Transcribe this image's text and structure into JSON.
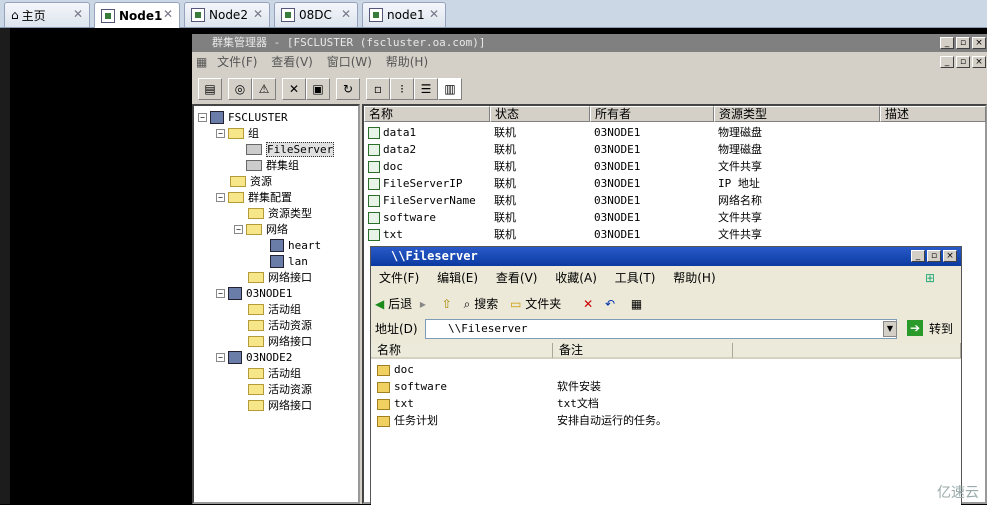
{
  "tabs": [
    {
      "label": "主页"
    },
    {
      "label": "Node1"
    },
    {
      "label": "Node2"
    },
    {
      "label": "08DC"
    },
    {
      "label": "node1"
    }
  ],
  "cluster_admin": {
    "title": "群集管理器 - [FSCLUSTER (fscluster.oa.com)]",
    "menu": [
      "文件(F)",
      "查看(V)",
      "窗口(W)",
      "帮助(H)"
    ],
    "tree": [
      {
        "label": "FSCLUSTER",
        "toggle": "-"
      },
      {
        "label": "组",
        "toggle": "-"
      },
      {
        "label": "FileServer"
      },
      {
        "label": "群集组"
      },
      {
        "label": "资源"
      },
      {
        "label": "群集配置",
        "toggle": "-"
      },
      {
        "label": "资源类型"
      },
      {
        "label": "网络",
        "toggle": "-"
      },
      {
        "label": "heart"
      },
      {
        "label": "lan"
      },
      {
        "label": "网络接口"
      },
      {
        "label": "03NODE1",
        "toggle": "-"
      },
      {
        "label": "活动组"
      },
      {
        "label": "活动资源"
      },
      {
        "label": "网络接口"
      },
      {
        "label": "03NODE2",
        "toggle": "-"
      },
      {
        "label": "活动组"
      },
      {
        "label": "活动资源"
      },
      {
        "label": "网络接口"
      }
    ],
    "columns": [
      "名称",
      "状态",
      "所有者",
      "资源类型",
      "描述"
    ],
    "rows": [
      [
        "data1",
        "联机",
        "03NODE1",
        "物理磁盘"
      ],
      [
        "data2",
        "联机",
        "03NODE1",
        "物理磁盘"
      ],
      [
        "doc",
        "联机",
        "03NODE1",
        "文件共享"
      ],
      [
        "FileServerIP",
        "联机",
        "03NODE1",
        "IP 地址"
      ],
      [
        "FileServerName",
        "联机",
        "03NODE1",
        "网络名称"
      ],
      [
        "software",
        "联机",
        "03NODE1",
        "文件共享"
      ],
      [
        "txt",
        "联机",
        "03NODE1",
        "文件共享"
      ]
    ]
  },
  "explorer": {
    "title": "\\\\Fileserver",
    "menu": [
      "文件(F)",
      "编辑(E)",
      "查看(V)",
      "收藏(A)",
      "工具(T)",
      "帮助(H)"
    ],
    "back": "后退",
    "search": "搜索",
    "folders": "文件夹",
    "address_label": "地址(D)",
    "address": "\\\\Fileserver",
    "go": "转到",
    "columns": [
      "名称",
      "备注"
    ],
    "rows": [
      [
        "doc",
        ""
      ],
      [
        "software",
        "软件安装"
      ],
      [
        "txt",
        "txt文档"
      ],
      [
        "任务计划",
        "安排自动运行的任务。"
      ]
    ]
  },
  "watermark": "亿速云"
}
